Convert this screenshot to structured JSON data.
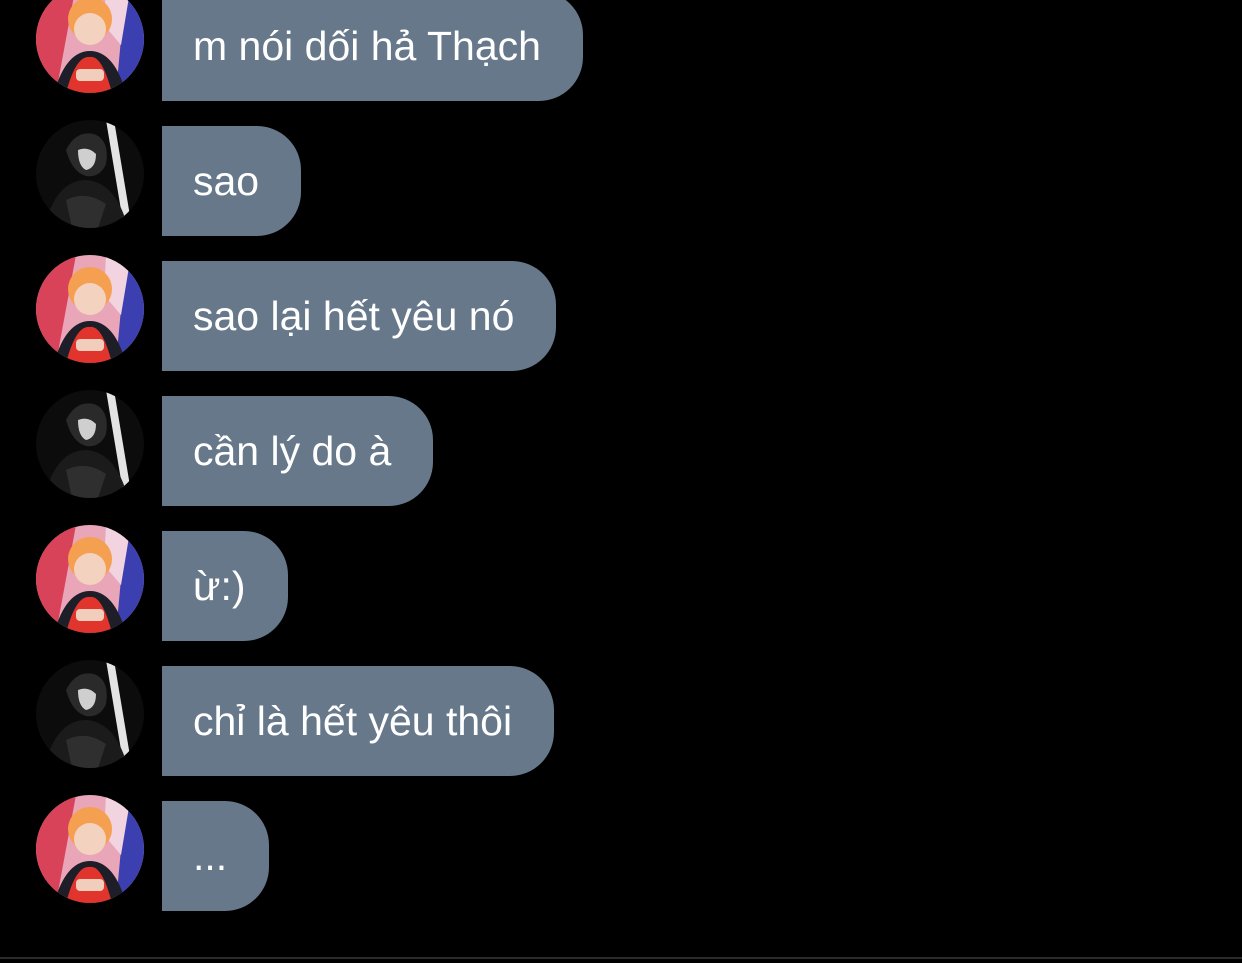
{
  "messages": [
    {
      "sender": "red-hair-user",
      "text": "m nói dối hả Thạch"
    },
    {
      "sender": "bw-user",
      "text": "sao"
    },
    {
      "sender": "red-hair-user",
      "text": "sao lại hết yêu nó"
    },
    {
      "sender": "bw-user",
      "text": "cần lý do à"
    },
    {
      "sender": "red-hair-user",
      "text": "ừ:)"
    },
    {
      "sender": "bw-user",
      "text": "chỉ là hết yêu thôi"
    },
    {
      "sender": "red-hair-user",
      "text": "..."
    }
  ],
  "colors": {
    "background": "#000000",
    "bubble": "#66788a",
    "text": "#ffffff"
  },
  "icons": {
    "avatar_a": "avatar-red-hair-photo",
    "avatar_b": "avatar-black-white-photo"
  }
}
